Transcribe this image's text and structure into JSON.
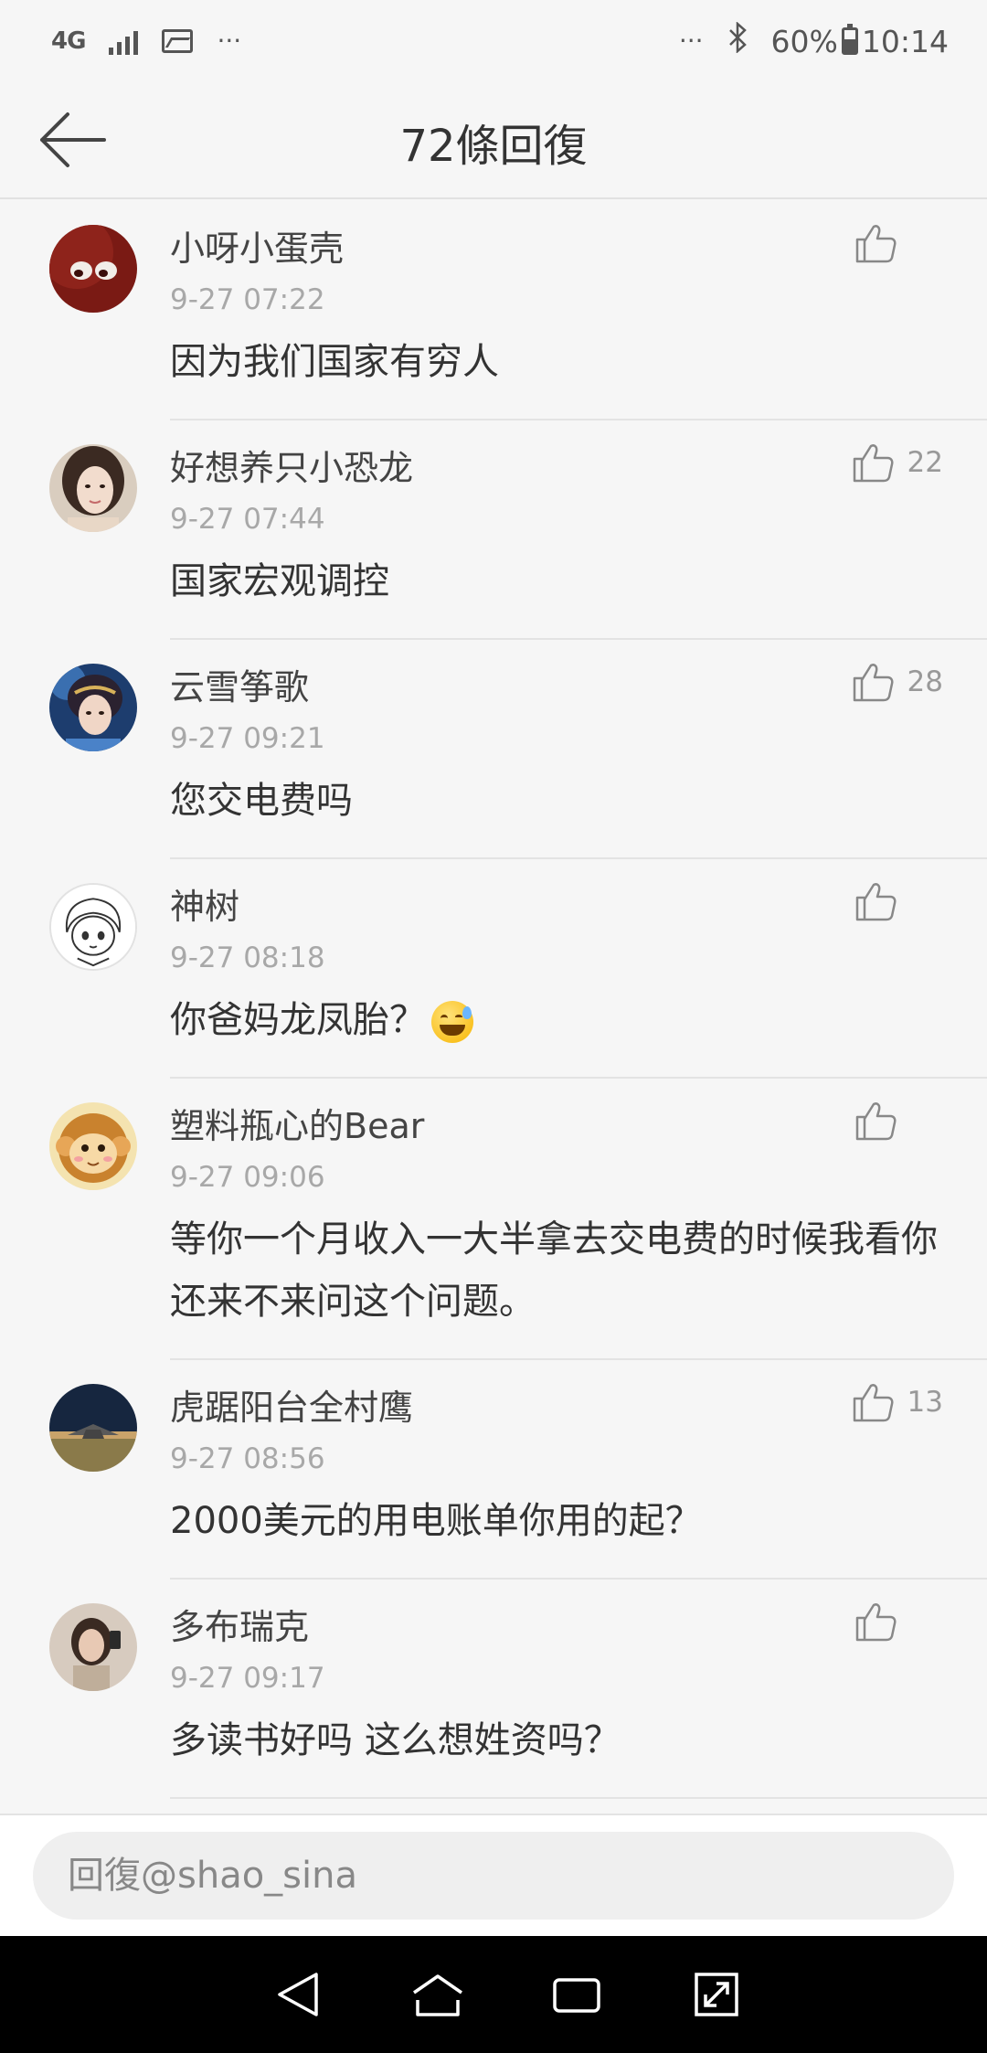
{
  "status": {
    "network": "4G",
    "more_left": "···",
    "more_right": "···",
    "battery": "60%",
    "time": "10:14"
  },
  "header": {
    "title": "72條回復"
  },
  "comments": [
    {
      "name": "小呀小蛋壳",
      "time": "9-27 07:22",
      "text": "因为我们国家有穷人",
      "likes": ""
    },
    {
      "name": "好想养只小恐龙",
      "time": "9-27 07:44",
      "text": "国家宏观调控",
      "likes": "22"
    },
    {
      "name": "云雪筝歌",
      "time": "9-27 09:21",
      "text": "您交电费吗",
      "likes": "28"
    },
    {
      "name": "神树",
      "time": "9-27 08:18",
      "text": "你爸妈龙凤胎？",
      "likes": ""
    },
    {
      "name": "塑料瓶心的Bear",
      "time": "9-27 09:06",
      "text": "等你一个月收入一大半拿去交电费的时候我看你还来不来问这个问题。",
      "likes": ""
    },
    {
      "name": "虎踞阳台全村鹰",
      "time": "9-27 08:56",
      "text": "2000美元的用电账单你用的起？",
      "likes": "13"
    },
    {
      "name": "多布瑞克",
      "time": "9-27 09:17",
      "text": "多读书好吗 这么想姓资吗？",
      "likes": ""
    }
  ],
  "reply": {
    "placeholder": "回復@shao_sina"
  },
  "colors": {
    "background": "#f6f6f6",
    "divider": "#e3e3e3",
    "meta_text": "#a8a8a8"
  }
}
